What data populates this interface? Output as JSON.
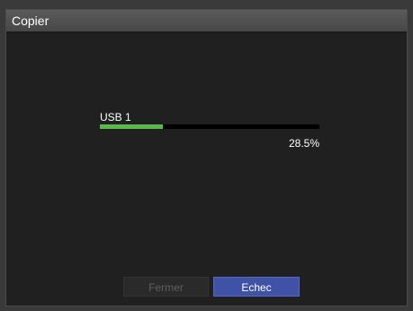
{
  "dialog": {
    "title": "Copier"
  },
  "progress": {
    "device_label": "USB 1",
    "percent_text": "28.5%",
    "value_percent": 28.5,
    "fill_color": "#5cb84c"
  },
  "buttons": {
    "close_label": "Fermer",
    "close_enabled": false,
    "fail_label": "Echec",
    "fail_color": "#3f52a6"
  }
}
